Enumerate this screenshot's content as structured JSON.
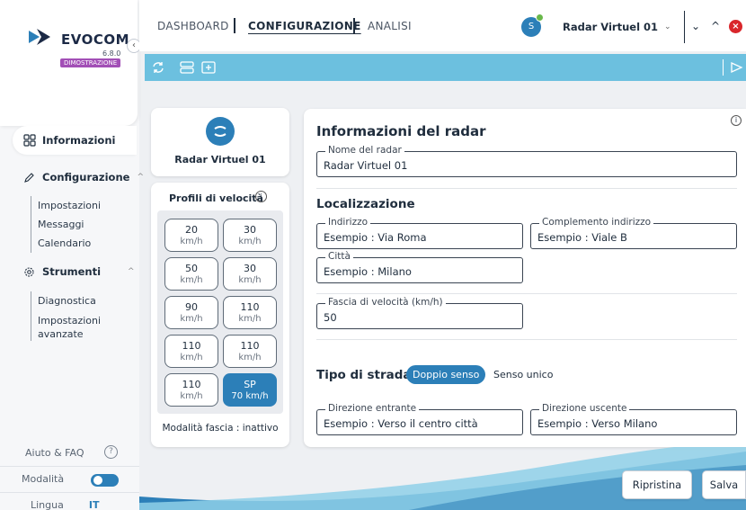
{
  "app": {
    "name": "EVOCOM",
    "version": "6.8.0",
    "badge": "DIMOSTRAZIONE"
  },
  "nav": {
    "info": "Informazioni",
    "config": {
      "label": "Configurazione",
      "items": [
        "Impostazioni",
        "Messaggi",
        "Calendario"
      ]
    },
    "tools": {
      "label": "Strumenti",
      "items": [
        "Diagnostica",
        "Impostazioni avanzate"
      ]
    },
    "help": "Aiuto & FAQ",
    "mode": "Modalità",
    "language_label": "Lingua",
    "language_value": "IT"
  },
  "tabs": [
    "DASHBOARD",
    "CONFIGURAZIONE",
    "ANALISI"
  ],
  "active_tab": "CONFIGURAZIONE",
  "radar": {
    "selected": "Radar Virtuel 01"
  },
  "profile": {
    "name": "Radar Virtuel 01"
  },
  "speed_profiles": {
    "title": "Profili di velocità",
    "buttons": [
      {
        "value": "20",
        "unit": "km/h"
      },
      {
        "value": "30",
        "unit": "km/h"
      },
      {
        "value": "50",
        "unit": "km/h"
      },
      {
        "value": "30",
        "unit": "km/h"
      },
      {
        "value": "90",
        "unit": "km/h"
      },
      {
        "value": "110",
        "unit": "km/h"
      },
      {
        "value": "110",
        "unit": "km/h"
      },
      {
        "value": "110",
        "unit": "km/h"
      },
      {
        "value": "110",
        "unit": "km/h"
      },
      {
        "value": "SP",
        "unit": "70 km/h"
      }
    ],
    "selected_index": 9,
    "mode_text": "Modalità fascia : inattivo"
  },
  "radar_info": {
    "title": "Informazioni del radar",
    "name_label": "Nome del radar",
    "name_value": "Radar Virtuel 01"
  },
  "location": {
    "title": "Localizzazione",
    "address_label": "Indirizzo",
    "address_value": "Esempio : Via Roma",
    "complement_label": "Complemento indirizzo",
    "complement_value": "Esempio : Viale B",
    "city_label": "Città",
    "city_value": "Esempio : Milano",
    "speed_label": "Fascia di velocità (km/h)",
    "speed_value": "50"
  },
  "road": {
    "title": "Tipo di strada",
    "option_selected": "Doppio senso",
    "option_other": "Senso unico",
    "in_label": "Direzione entrante",
    "in_value": "Esempio : Verso il centro città",
    "out_label": "Direzione uscente",
    "out_value": "Esempio : Verso Milano"
  },
  "actions": {
    "reset": "Ripristina",
    "save": "Salva"
  },
  "colors": {
    "accent": "#2c7fb8",
    "toolbar": "#6cc0df",
    "badge": "#a24fb6",
    "close": "#d9262b",
    "online": "#69b84a"
  }
}
